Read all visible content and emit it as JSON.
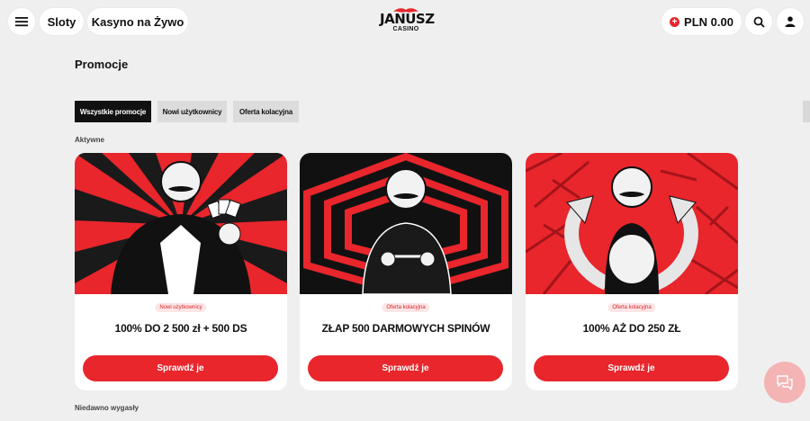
{
  "header": {
    "menu_icon": "hamburger-icon",
    "nav": [
      "Sloty",
      "Kasyno na Żywo"
    ],
    "logo": {
      "name": "JANUSZ",
      "sub": "CASINO"
    },
    "balance": "PLN 0.00",
    "search_icon": "search-icon",
    "user_icon": "user-icon"
  },
  "page": {
    "title": "Promocje"
  },
  "filters": [
    "Wszystkie promocje",
    "Nowi użytkownicy",
    "Oferta kolacyjna"
  ],
  "sections": {
    "active": "Aktywne",
    "expired": "Niedawno wygasły"
  },
  "promos": [
    {
      "badge": "Nowi użytkownicy",
      "title": "100% DO 2 500 zł + 500 DS",
      "cta": "Sprawdź je"
    },
    {
      "badge": "Oferta kolacyjna",
      "title": "ZŁAP 500 DARMOWYCH SPINÓW",
      "cta": "Sprawdź je"
    },
    {
      "badge": "Oferta kolacyjna",
      "title": "100% AŻ DO 250 ZŁ",
      "cta": "Sprawdź je"
    }
  ],
  "colors": {
    "accent": "#e8262c",
    "background": "#efefef",
    "active_tab": "#111111"
  },
  "chat_icon": "chat-bubbles-icon"
}
